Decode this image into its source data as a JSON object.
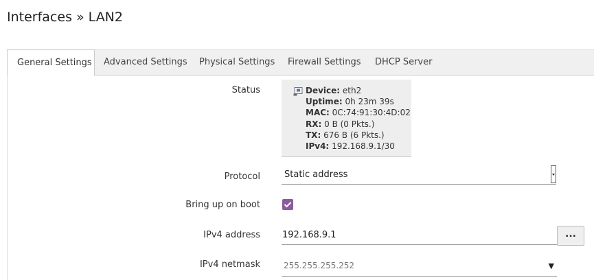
{
  "page": {
    "title": "Interfaces » LAN2"
  },
  "tabs": [
    {
      "label": "General Settings",
      "active": true
    },
    {
      "label": "Advanced Settings",
      "active": false
    },
    {
      "label": "Physical Settings",
      "active": false
    },
    {
      "label": "Firewall Settings",
      "active": false
    },
    {
      "label": "DHCP Server",
      "active": false
    }
  ],
  "status": {
    "label": "Status",
    "device_key": "Device:",
    "device_val": "eth2",
    "uptime_key": "Uptime:",
    "uptime_val": "0h 23m 39s",
    "mac_key": "MAC:",
    "mac_val": "0C:74:91:30:4D:02",
    "rx_key": "RX:",
    "rx_val": "0 B (0 Pkts.)",
    "tx_key": "TX:",
    "tx_val": "676 B (6 Pkts.)",
    "ipv4_key": "IPv4:",
    "ipv4_val": "192.168.9.1/30"
  },
  "protocol": {
    "label": "Protocol",
    "value": "Static address"
  },
  "boot": {
    "label": "Bring up on boot",
    "checked": true
  },
  "ipv4_address": {
    "label": "IPv4 address",
    "value": "192.168.9.1",
    "button_label": "..."
  },
  "ipv4_netmask": {
    "label": "IPv4 netmask",
    "value": "255.255.255.252",
    "arrow": "▼"
  },
  "colors": {
    "accent": "#8b5c9e",
    "tabbar_bg": "#f0f0f0",
    "status_bg": "#eeeeee"
  },
  "icons": {
    "status": "network-port-icon",
    "checkbox": "check-icon"
  }
}
